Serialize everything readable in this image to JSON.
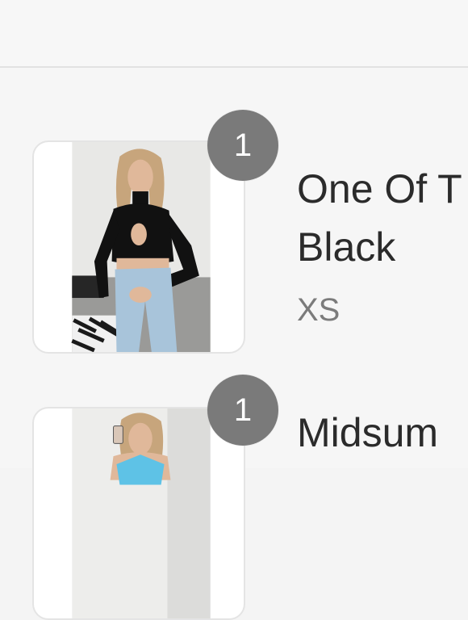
{
  "cart": {
    "items": [
      {
        "quantity": "1",
        "title": "One Of T Black",
        "variant": "XS",
        "image": "product-photo-black-cutout-top"
      },
      {
        "quantity": "1",
        "title": "Midsum",
        "variant": "",
        "image": "product-photo-blue-halter-top"
      }
    ]
  },
  "colors": {
    "badge": "#7a7a7a",
    "title": "#2b2b2b",
    "variant": "#7b7b7b",
    "background": "#f6f6f6"
  }
}
